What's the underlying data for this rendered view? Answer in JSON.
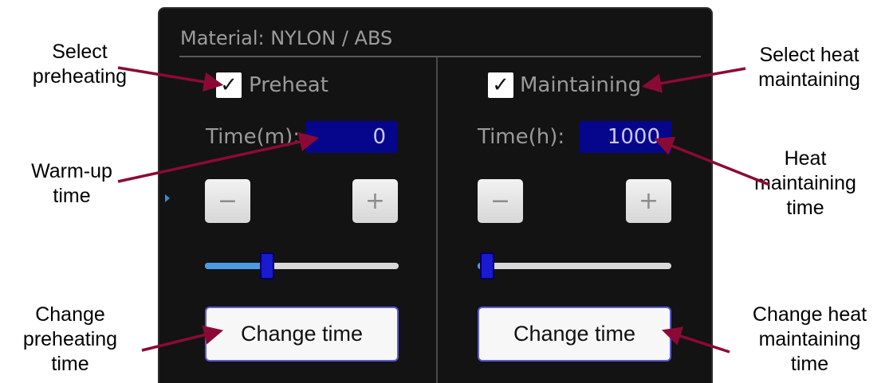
{
  "panel": {
    "material_title": "Material: NYLON / ABS"
  },
  "left": {
    "checkbox_label": "Preheat",
    "checked": true,
    "time_label": "Time(m):",
    "time_value": "0",
    "minus_label": "−",
    "plus_label": "+",
    "slider_fraction": 0.32,
    "change_label": "Change time"
  },
  "right": {
    "checkbox_label": "Maintaining",
    "checked": true,
    "time_label": "Time(h):",
    "time_value": "1000",
    "minus_label": "−",
    "plus_label": "+",
    "slider_fraction": 0.05,
    "change_label": "Change time"
  },
  "checkmark": "✓",
  "annotations": {
    "select_preheating": "Select\npreheating",
    "warm_up_time": "Warm-up\ntime",
    "change_preheating_time": "Change\npreheating\ntime",
    "select_heat_maintaining": "Select heat\nmaintaining",
    "heat_maintaining_time": "Heat\nmaintaining\ntime",
    "change_heat_maintaining_time": "Change  heat\nmaintaining\ntime"
  },
  "colors": {
    "arrow": "#8b0a35",
    "panel_bg": "#131313",
    "value_bg": "#06068c",
    "slider_fill": "#4a9be6",
    "slider_thumb": "#1a1ad0"
  }
}
